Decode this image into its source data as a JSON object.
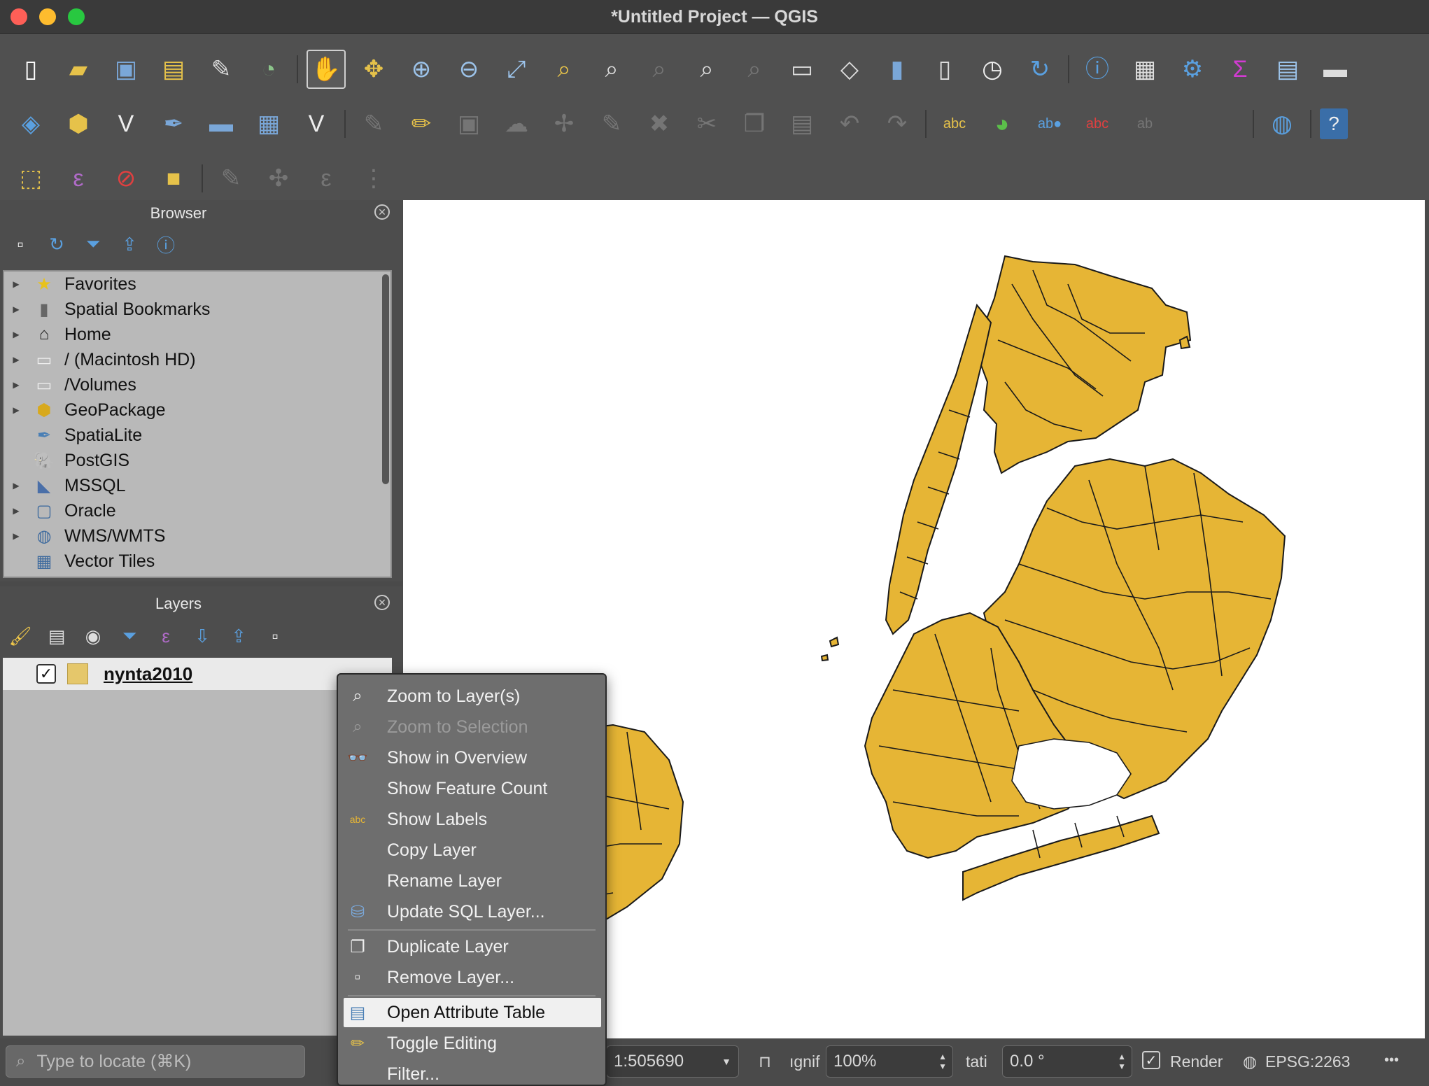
{
  "window": {
    "title": "*Untitled Project — QGIS"
  },
  "toolbar": {
    "row1": [
      "new-project-icon",
      "open-project-icon",
      "save-project-icon",
      "new-print-layout-icon",
      "layout-manager-icon",
      "style-manager-icon",
      "pan-icon",
      "pan-to-selection-icon",
      "zoom-in-icon",
      "zoom-out-icon",
      "zoom-full-icon",
      "zoom-to-selection-icon",
      "zoom-to-layer-icon",
      "zoom-native-icon",
      "zoom-last-icon",
      "zoom-next-icon",
      "new-map-view-icon",
      "new-3d-view-icon",
      "new-bookmark-icon",
      "show-bookmarks-icon",
      "temporal-controller-icon",
      "refresh-icon",
      "identify-icon",
      "open-attribute-table-toolbar-icon",
      "toolbox-icon",
      "statistical-summary-icon",
      "field-calculator-icon",
      "measure-icon"
    ],
    "row2": [
      "data-source-manager-icon",
      "new-geopackage-layer-icon",
      "new-vector-layer-icon",
      "new-spatialite-layer-icon",
      "new-temporary-layer-icon",
      "new-virtual-layer-icon",
      "new-mesh-layer-icon",
      "current-edits-icon",
      "toggle-editing-icon",
      "save-edits-icon",
      "digitize-icon",
      "vertex-tool-icon",
      "modify-attributes-icon",
      "delete-selected-icon",
      "cut-icon",
      "copy-icon",
      "paste-icon",
      "undo-icon",
      "redo-icon",
      "label-toolbar-icon",
      "diagram-icon",
      "pin-labels-icon",
      "highlight-labels-icon",
      "move-label-icon",
      "metasearch-icon",
      "help-icon"
    ],
    "row3": [
      "select-features-icon",
      "select-by-expression-icon",
      "deselect-all-icon",
      "select-by-location-icon",
      "annotation-icon",
      "pin-annotation-icon",
      "text-annotation-icon",
      "form-annotation-icon"
    ]
  },
  "browser": {
    "title": "Browser",
    "items": [
      {
        "label": "Favorites",
        "icon": "star-icon",
        "expandable": true
      },
      {
        "label": "Spatial Bookmarks",
        "icon": "bookmark-icon",
        "expandable": true
      },
      {
        "label": "Home",
        "icon": "home-icon",
        "expandable": true
      },
      {
        "label": "/ (Macintosh HD)",
        "icon": "folder-icon",
        "expandable": true
      },
      {
        "label": "/Volumes",
        "icon": "folder-icon",
        "expandable": true
      },
      {
        "label": "GeoPackage",
        "icon": "geopackage-icon",
        "expandable": true
      },
      {
        "label": "SpatiaLite",
        "icon": "spatialite-icon",
        "expandable": false
      },
      {
        "label": "PostGIS",
        "icon": "postgis-icon",
        "expandable": false
      },
      {
        "label": "MSSQL",
        "icon": "mssql-icon",
        "expandable": true
      },
      {
        "label": "Oracle",
        "icon": "oracle-icon",
        "expandable": true
      },
      {
        "label": "WMS/WMTS",
        "icon": "globe-icon",
        "expandable": true
      },
      {
        "label": "Vector Tiles",
        "icon": "grid-icon",
        "expandable": false
      }
    ]
  },
  "layers": {
    "title": "Layers",
    "items": [
      {
        "name": "nynta2010",
        "checked": true,
        "fill": "#e5c76b"
      }
    ]
  },
  "map": {
    "fill_color": "#e6b535",
    "stroke_color": "#1a1a1a",
    "background": "#ffffff"
  },
  "context_menu": {
    "items": [
      {
        "label": "Zoom to Layer(s)",
        "icon": "zoom-layer-icon",
        "enabled": true
      },
      {
        "label": "Zoom to Selection",
        "icon": "zoom-selection-icon",
        "enabled": false
      },
      {
        "label": "Show in Overview",
        "icon": "overview-icon",
        "enabled": true
      },
      {
        "label": "Show Feature Count",
        "icon": "",
        "enabled": true
      },
      {
        "label": "Show Labels",
        "icon": "labels-icon",
        "enabled": true
      },
      {
        "label": "Copy Layer",
        "icon": "",
        "enabled": true
      },
      {
        "label": "Rename Layer",
        "icon": "",
        "enabled": true
      },
      {
        "label": "Update SQL Layer...",
        "icon": "database-icon",
        "enabled": true
      },
      {
        "label": "Duplicate Layer",
        "icon": "duplicate-icon",
        "enabled": true
      },
      {
        "label": "Remove Layer...",
        "icon": "remove-layer-icon",
        "enabled": true
      },
      {
        "label": "Open Attribute Table",
        "icon": "table-icon",
        "enabled": true,
        "highlighted": true
      },
      {
        "label": "Toggle Editing",
        "icon": "pencil-icon",
        "enabled": true
      },
      {
        "label": "Filter...",
        "icon": "",
        "enabled": true
      }
    ]
  },
  "status": {
    "locate_placeholder": "Type to locate (⌘K)",
    "scale": "1:505690",
    "magnifier_label": "ıgnif",
    "magnifier": "100%",
    "rotation_label": "tati",
    "rotation": "0.0 °",
    "render_label": "Render",
    "render_checked": true,
    "crs": "EPSG:2263"
  }
}
